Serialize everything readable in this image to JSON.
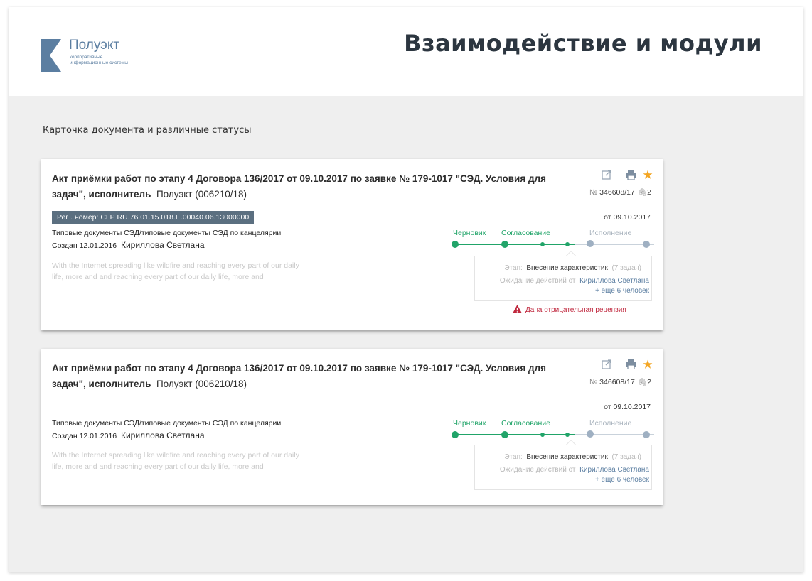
{
  "header": {
    "logo_name": "Полуэкт",
    "logo_subtitle": "корпоративные информационные системы",
    "page_title": "Взаимодействие и модули"
  },
  "section_title": "Карточка документа и различные статусы",
  "colors": {
    "brand": "#5b7ea1",
    "active_step": "#21a469",
    "inactive_step": "#9fb0c2",
    "warning": "#c0283e",
    "star": "#f4a623",
    "reg_badge": "#5b6f80"
  },
  "cards": [
    {
      "title": "Акт приёмки работ по этапу 4 Договора 136/2017 от 09.10.2017 по заявке № 179-1017 \"СЭД. Условия для задач\", исполнитель",
      "executor": "Полуэкт (006210/18)",
      "reg_number": "Рег . номер: СГР RU.76.01.15.018.Е.00040.06.13000000",
      "doc_type": "Типовые документы СЭД/типовые документы СЭД по канцелярии",
      "created_label": "Создан 12.01.2016",
      "created_by": "Кириллова Светлана",
      "description": "With the Internet spreading like wildfire and reaching every part of our daily life, more and and reaching every part of our daily life, more and",
      "icons": [
        "external-link-icon",
        "print-icon",
        "star-icon"
      ],
      "number_prefix": "№",
      "number": "346608/17",
      "attachments": "2",
      "date": "от 09.10.2017",
      "steps": [
        {
          "label": "Черновик",
          "status": "done"
        },
        {
          "label": "Согласование",
          "status": "current"
        },
        {
          "label": "Исполнение",
          "status": "pending"
        }
      ],
      "popup": {
        "stage_label": "Этап:",
        "stage_value": "Внесение характеристик",
        "stage_count": "(7 задач)",
        "waiting_label": "Ожидание действий от",
        "waiting_person": "Кириллова Светлана",
        "waiting_more": "+ еще 6 человек"
      },
      "warning": "Дана отрицательная рецензия"
    },
    {
      "title": "Акт приёмки работ по этапу 4 Договора 136/2017 от 09.10.2017 по заявке № 179-1017 \"СЭД. Условия для задач\", исполнитель",
      "executor": "Полуэкт (006210/18)",
      "doc_type": "Типовые документы СЭД/типовые документы СЭД по канцелярии",
      "created_label": "Создан 12.01.2016",
      "created_by": "Кириллова Светлана",
      "description": "With the Internet spreading like wildfire and reaching every part of our daily life, more and and reaching every part of our daily life, more and",
      "icons": [
        "external-link-icon",
        "print-icon",
        "star-icon"
      ],
      "number_prefix": "№",
      "number": "346608/17",
      "attachments": "2",
      "date": "от 09.10.2017",
      "steps": [
        {
          "label": "Черновик",
          "status": "done"
        },
        {
          "label": "Согласование",
          "status": "current"
        },
        {
          "label": "Исполнение",
          "status": "pending"
        }
      ],
      "popup": {
        "stage_label": "Этап:",
        "stage_value": "Внесение характеристик",
        "stage_count": "(7 задач)",
        "waiting_label": "Ожидание действий от",
        "waiting_person": "Кириллова Светлана",
        "waiting_more": "+ еще 6 человек"
      }
    }
  ]
}
